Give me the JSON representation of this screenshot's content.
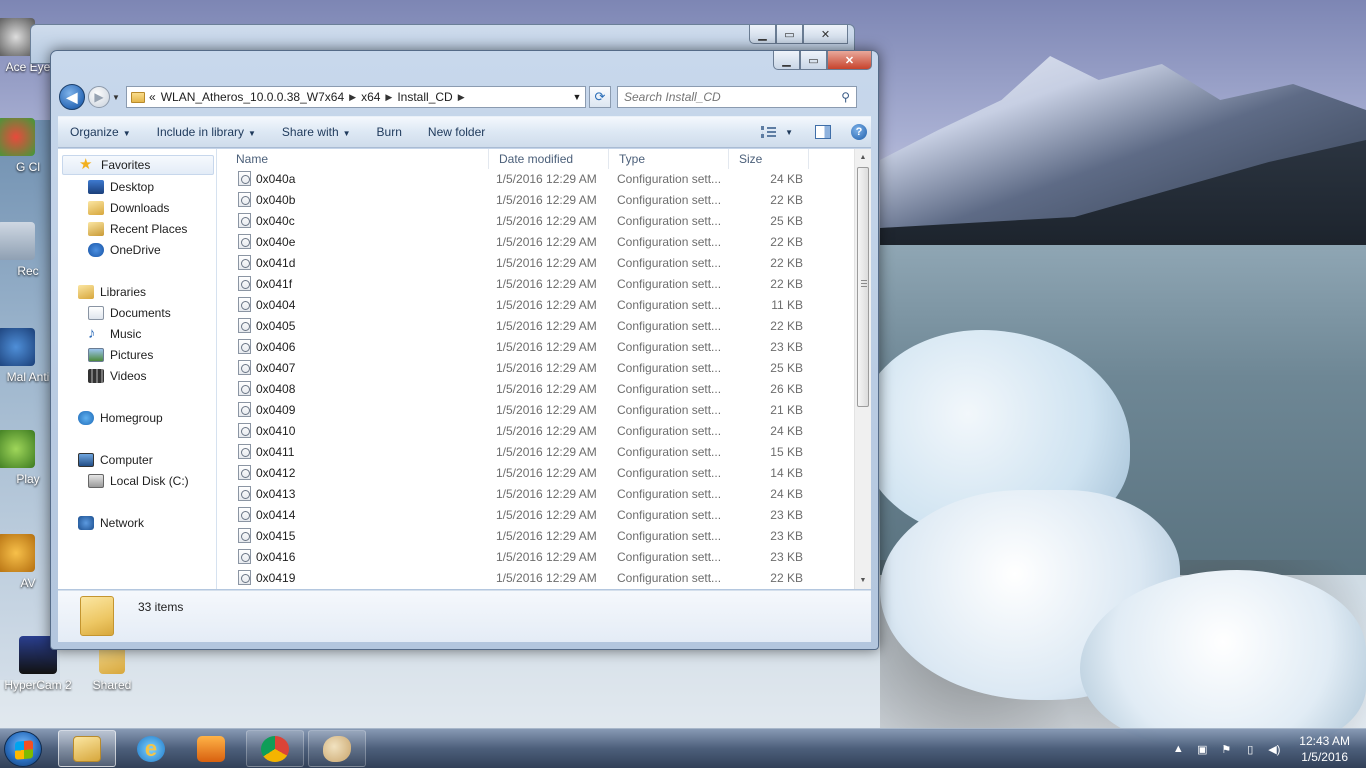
{
  "desktop": {
    "icons": [
      {
        "label": "Ace Eye"
      },
      {
        "label": "G Cl"
      },
      {
        "label": "Rec"
      },
      {
        "label": "Mal Anti"
      },
      {
        "label": "Play"
      },
      {
        "label": "AV"
      },
      {
        "label": "HyperCam 2"
      },
      {
        "label": "Shared"
      }
    ]
  },
  "window": {
    "address": {
      "overflow": "«",
      "segments": [
        "WLAN_Atheros_10.0.0.38_W7x64",
        "x64",
        "Install_CD"
      ]
    },
    "search": {
      "placeholder": "Search Install_CD"
    },
    "toolbar": {
      "organize": "Organize",
      "include_in_library": "Include in library",
      "share_with": "Share with",
      "burn": "Burn",
      "new_folder": "New folder"
    },
    "nav": {
      "favorites": "Favorites",
      "desktop": "Desktop",
      "downloads": "Downloads",
      "recent_places": "Recent Places",
      "onedrive": "OneDrive",
      "libraries": "Libraries",
      "documents": "Documents",
      "music": "Music",
      "pictures": "Pictures",
      "videos": "Videos",
      "homegroup": "Homegroup",
      "computer": "Computer",
      "local_disk": "Local Disk (C:)",
      "network": "Network"
    },
    "columns": {
      "name": "Name",
      "date": "Date modified",
      "type": "Type",
      "size": "Size"
    },
    "files": [
      {
        "name": "0x040a",
        "date": "1/5/2016 12:29 AM",
        "type": "Configuration sett...",
        "size": "24 KB"
      },
      {
        "name": "0x040b",
        "date": "1/5/2016 12:29 AM",
        "type": "Configuration sett...",
        "size": "22 KB"
      },
      {
        "name": "0x040c",
        "date": "1/5/2016 12:29 AM",
        "type": "Configuration sett...",
        "size": "25 KB"
      },
      {
        "name": "0x040e",
        "date": "1/5/2016 12:29 AM",
        "type": "Configuration sett...",
        "size": "22 KB"
      },
      {
        "name": "0x041d",
        "date": "1/5/2016 12:29 AM",
        "type": "Configuration sett...",
        "size": "22 KB"
      },
      {
        "name": "0x041f",
        "date": "1/5/2016 12:29 AM",
        "type": "Configuration sett...",
        "size": "22 KB"
      },
      {
        "name": "0x0404",
        "date": "1/5/2016 12:29 AM",
        "type": "Configuration sett...",
        "size": "11 KB"
      },
      {
        "name": "0x0405",
        "date": "1/5/2016 12:29 AM",
        "type": "Configuration sett...",
        "size": "22 KB"
      },
      {
        "name": "0x0406",
        "date": "1/5/2016 12:29 AM",
        "type": "Configuration sett...",
        "size": "23 KB"
      },
      {
        "name": "0x0407",
        "date": "1/5/2016 12:29 AM",
        "type": "Configuration sett...",
        "size": "25 KB"
      },
      {
        "name": "0x0408",
        "date": "1/5/2016 12:29 AM",
        "type": "Configuration sett...",
        "size": "26 KB"
      },
      {
        "name": "0x0409",
        "date": "1/5/2016 12:29 AM",
        "type": "Configuration sett...",
        "size": "21 KB"
      },
      {
        "name": "0x0410",
        "date": "1/5/2016 12:29 AM",
        "type": "Configuration sett...",
        "size": "24 KB"
      },
      {
        "name": "0x0411",
        "date": "1/5/2016 12:29 AM",
        "type": "Configuration sett...",
        "size": "15 KB"
      },
      {
        "name": "0x0412",
        "date": "1/5/2016 12:29 AM",
        "type": "Configuration sett...",
        "size": "14 KB"
      },
      {
        "name": "0x0413",
        "date": "1/5/2016 12:29 AM",
        "type": "Configuration sett...",
        "size": "24 KB"
      },
      {
        "name": "0x0414",
        "date": "1/5/2016 12:29 AM",
        "type": "Configuration sett...",
        "size": "23 KB"
      },
      {
        "name": "0x0415",
        "date": "1/5/2016 12:29 AM",
        "type": "Configuration sett...",
        "size": "23 KB"
      },
      {
        "name": "0x0416",
        "date": "1/5/2016 12:29 AM",
        "type": "Configuration sett...",
        "size": "23 KB"
      },
      {
        "name": "0x0419",
        "date": "1/5/2016 12:29 AM",
        "type": "Configuration sett...",
        "size": "22 KB"
      }
    ],
    "status": {
      "item_count": "33 items"
    }
  },
  "taskbar": {
    "time": "12:43 AM",
    "date": "1/5/2016"
  }
}
